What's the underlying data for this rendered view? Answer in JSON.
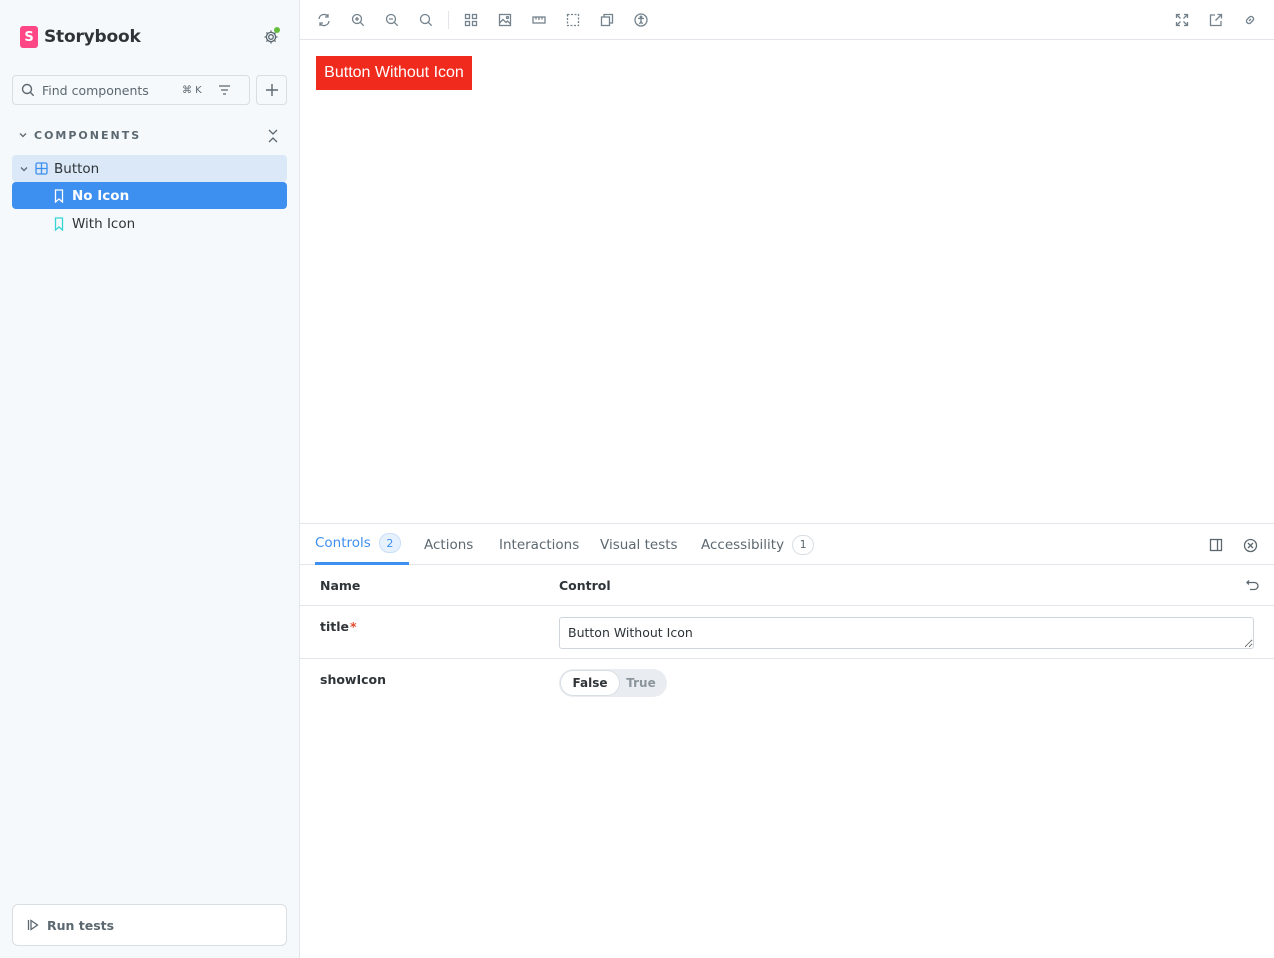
{
  "sidebar": {
    "brand": {
      "logo_letter": "S",
      "name": "Storybook"
    },
    "search": {
      "placeholder": "Find components",
      "shortcut": "⌘ K"
    },
    "section_title": "COMPONENTS",
    "tree": {
      "component": "Button",
      "stories": [
        {
          "label": "No Icon",
          "active": true
        },
        {
          "label": "With Icon",
          "active": false
        }
      ]
    },
    "run_tests_label": "Run tests"
  },
  "preview": {
    "button_label": "Button Without Icon",
    "button_color": "#f02b1d"
  },
  "panel": {
    "tabs": [
      {
        "label": "Controls",
        "badge": "2"
      },
      {
        "label": "Actions"
      },
      {
        "label": "Interactions"
      },
      {
        "label": "Visual tests"
      },
      {
        "label": "Accessibility",
        "badge": "1"
      }
    ],
    "headers": {
      "name": "Name",
      "control": "Control"
    },
    "rows": [
      {
        "name": "title",
        "required_mark": "*",
        "value": "Button Without Icon"
      },
      {
        "name": "showIcon",
        "options": [
          "False",
          "True"
        ],
        "selected": "False"
      }
    ]
  },
  "colors": {
    "accent": "#3d8ff0",
    "brand": "#ff4785",
    "status_dot": "#66bf3c"
  }
}
